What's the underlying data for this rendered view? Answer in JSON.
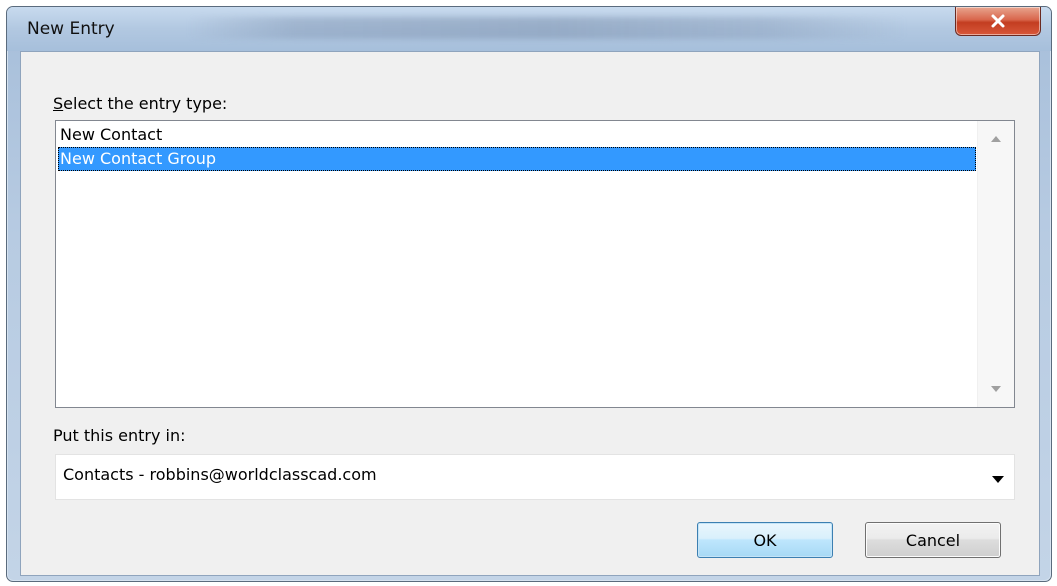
{
  "window": {
    "title": "New Entry"
  },
  "entry_type": {
    "label_prefix": "",
    "label_underlined": "S",
    "label_rest": "elect the entry type:",
    "items": [
      {
        "label": "New Contact",
        "selected": false
      },
      {
        "label": "New Contact Group",
        "selected": true
      }
    ]
  },
  "location": {
    "label": "Put this entry in:",
    "selected_value": "Contacts - robbins@worldclasscad.com"
  },
  "buttons": {
    "ok_label": "OK",
    "cancel_label": "Cancel"
  },
  "colors": {
    "selection": "#3399ff",
    "close_button": "#c33d21"
  }
}
